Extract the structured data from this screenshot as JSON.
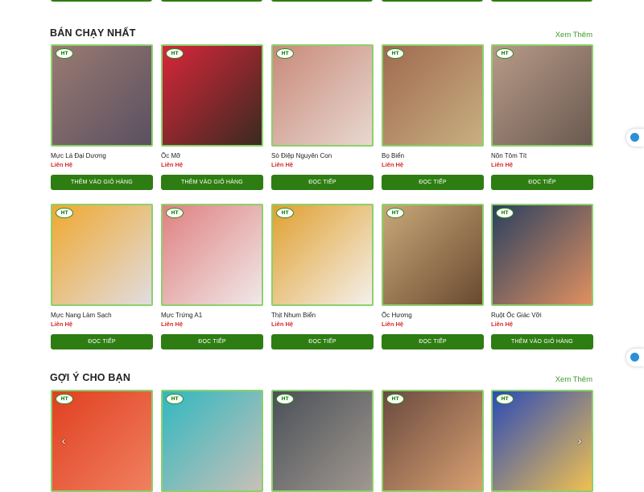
{
  "sections": {
    "bestseller": {
      "title": "BÁN CHẠY NHẤT",
      "see_more": "Xem Thêm"
    },
    "suggest": {
      "title": "GỢI Ý CHO BẠN",
      "see_more": "Xem Thêm"
    }
  },
  "logo_text": "HT",
  "products": [
    {
      "name": "Mực Lá Đại Dương",
      "price": "Liên Hệ",
      "button": "THÊM VÀO GIỎ HÀNG",
      "colors": [
        "#9a7a72",
        "#5a5060"
      ]
    },
    {
      "name": "Ốc Mỡ",
      "price": "Liên Hệ",
      "button": "THÊM VÀO GIỎ HÀNG",
      "colors": [
        "#d8263a",
        "#3a2a20"
      ]
    },
    {
      "name": "Sò Điệp Nguyên Con",
      "price": "Liên Hệ",
      "button": "ĐỌC TIẾP",
      "colors": [
        "#c98a7a",
        "#e8d8d0"
      ]
    },
    {
      "name": "Bọ Biển",
      "price": "Liên Hệ",
      "button": "ĐỌC TIẾP",
      "colors": [
        "#a06a50",
        "#c8b080"
      ]
    },
    {
      "name": "Nõn Tôm Tít",
      "price": "Liên Hệ",
      "button": "ĐỌC TIẾP",
      "colors": [
        "#b89a88",
        "#6a5a50"
      ]
    },
    {
      "name": "Mực Nang Làm Sạch",
      "price": "Liên Hệ",
      "button": "ĐỌC TIẾP",
      "colors": [
        "#f0a830",
        "#e0dde0"
      ]
    },
    {
      "name": "Mực Trứng A1",
      "price": "Liên Hệ",
      "button": "ĐỌC TIẾP",
      "colors": [
        "#e08080",
        "#f0e8e8"
      ]
    },
    {
      "name": "Thịt Nhum Biển",
      "price": "Liên Hệ",
      "button": "ĐỌC TIẾP",
      "colors": [
        "#e0a030",
        "#f4f0ea"
      ]
    },
    {
      "name": "Ốc Hương",
      "price": "Liên Hệ",
      "button": "ĐỌC TIẾP",
      "colors": [
        "#c8a878",
        "#6a4a30"
      ]
    },
    {
      "name": "Ruột Ốc Giác Vỡi",
      "price": "Liên Hệ",
      "button": "THÊM VÀO GIỎ HÀNG",
      "colors": [
        "#2a4060",
        "#e09060"
      ]
    }
  ],
  "suggested": [
    {
      "colors": [
        "#e04020",
        "#f08060"
      ]
    },
    {
      "colors": [
        "#30b8c0",
        "#c8c0b8"
      ]
    },
    {
      "colors": [
        "#4a5058",
        "#a09890"
      ]
    },
    {
      "colors": [
        "#6a4a40",
        "#d8a070"
      ]
    },
    {
      "colors": [
        "#2a4ab8",
        "#f0c050"
      ]
    }
  ],
  "arrows": {
    "prev": "‹",
    "next": "›"
  }
}
